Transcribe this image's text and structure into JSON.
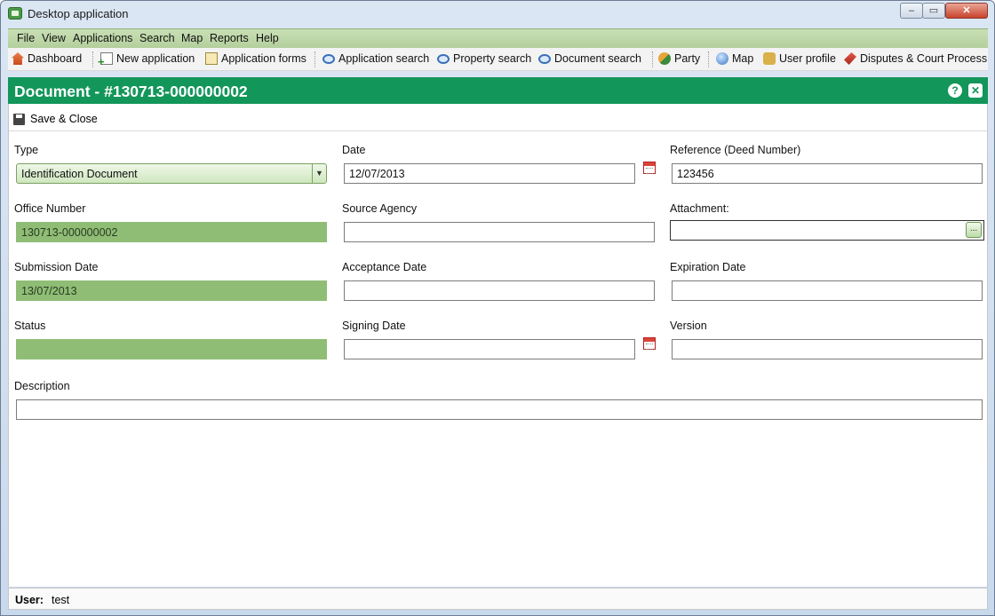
{
  "window": {
    "title": "Desktop application",
    "min_label": "‒",
    "max_label": "▭",
    "close_label": "✕"
  },
  "menu": [
    "File",
    "View",
    "Applications",
    "Search",
    "Map",
    "Reports",
    "Help"
  ],
  "toolbar": {
    "dashboard": "Dashboard",
    "new_application": "New application",
    "application_forms": "Application forms",
    "application_search": "Application search",
    "property_search": "Property search",
    "document_search": "Document search",
    "party": "Party",
    "map": "Map",
    "user_profile": "User profile",
    "disputes": "Disputes & Court Process"
  },
  "panel": {
    "title": "Document - #130713-000000002",
    "help_label": "?",
    "close_label": "✕"
  },
  "form": {
    "save_close": "Save & Close",
    "type": {
      "label": "Type",
      "value": "Identification Document"
    },
    "date": {
      "label": "Date",
      "value": "12/07/2013"
    },
    "reference": {
      "label": "Reference (Deed Number)",
      "value": "123456"
    },
    "office_number": {
      "label": "Office Number",
      "value": "130713-000000002"
    },
    "source_agency": {
      "label": "Source Agency",
      "value": ""
    },
    "attachment": {
      "label": "Attachment:",
      "value": "",
      "browse_label": "..."
    },
    "submission_date": {
      "label": "Submission Date",
      "value": "13/07/2013"
    },
    "acceptance_date": {
      "label": "Acceptance Date",
      "value": ""
    },
    "expiration_date": {
      "label": "Expiration Date",
      "value": ""
    },
    "status": {
      "label": "Status",
      "value": ""
    },
    "signing_date": {
      "label": "Signing Date",
      "value": ""
    },
    "version": {
      "label": "Version",
      "value": ""
    },
    "description": {
      "label": "Description",
      "value": ""
    }
  },
  "statusbar": {
    "user_label": "User:",
    "user_value": "test"
  },
  "colors": {
    "header": "#13965a",
    "menubar": "#b3cf9c",
    "readonly_field": "#8fbd75"
  }
}
